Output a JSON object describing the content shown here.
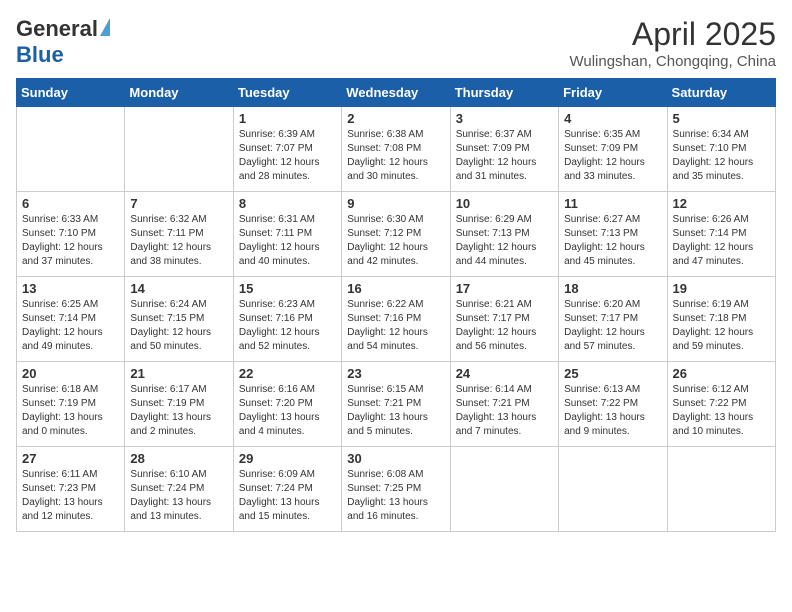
{
  "header": {
    "logo_general": "General",
    "logo_blue": "Blue",
    "month": "April 2025",
    "location": "Wulingshan, Chongqing, China"
  },
  "days_of_week": [
    "Sunday",
    "Monday",
    "Tuesday",
    "Wednesday",
    "Thursday",
    "Friday",
    "Saturday"
  ],
  "weeks": [
    [
      {
        "day": "",
        "info": ""
      },
      {
        "day": "",
        "info": ""
      },
      {
        "day": "1",
        "info": "Sunrise: 6:39 AM\nSunset: 7:07 PM\nDaylight: 12 hours and 28 minutes."
      },
      {
        "day": "2",
        "info": "Sunrise: 6:38 AM\nSunset: 7:08 PM\nDaylight: 12 hours and 30 minutes."
      },
      {
        "day": "3",
        "info": "Sunrise: 6:37 AM\nSunset: 7:09 PM\nDaylight: 12 hours and 31 minutes."
      },
      {
        "day": "4",
        "info": "Sunrise: 6:35 AM\nSunset: 7:09 PM\nDaylight: 12 hours and 33 minutes."
      },
      {
        "day": "5",
        "info": "Sunrise: 6:34 AM\nSunset: 7:10 PM\nDaylight: 12 hours and 35 minutes."
      }
    ],
    [
      {
        "day": "6",
        "info": "Sunrise: 6:33 AM\nSunset: 7:10 PM\nDaylight: 12 hours and 37 minutes."
      },
      {
        "day": "7",
        "info": "Sunrise: 6:32 AM\nSunset: 7:11 PM\nDaylight: 12 hours and 38 minutes."
      },
      {
        "day": "8",
        "info": "Sunrise: 6:31 AM\nSunset: 7:11 PM\nDaylight: 12 hours and 40 minutes."
      },
      {
        "day": "9",
        "info": "Sunrise: 6:30 AM\nSunset: 7:12 PM\nDaylight: 12 hours and 42 minutes."
      },
      {
        "day": "10",
        "info": "Sunrise: 6:29 AM\nSunset: 7:13 PM\nDaylight: 12 hours and 44 minutes."
      },
      {
        "day": "11",
        "info": "Sunrise: 6:27 AM\nSunset: 7:13 PM\nDaylight: 12 hours and 45 minutes."
      },
      {
        "day": "12",
        "info": "Sunrise: 6:26 AM\nSunset: 7:14 PM\nDaylight: 12 hours and 47 minutes."
      }
    ],
    [
      {
        "day": "13",
        "info": "Sunrise: 6:25 AM\nSunset: 7:14 PM\nDaylight: 12 hours and 49 minutes."
      },
      {
        "day": "14",
        "info": "Sunrise: 6:24 AM\nSunset: 7:15 PM\nDaylight: 12 hours and 50 minutes."
      },
      {
        "day": "15",
        "info": "Sunrise: 6:23 AM\nSunset: 7:16 PM\nDaylight: 12 hours and 52 minutes."
      },
      {
        "day": "16",
        "info": "Sunrise: 6:22 AM\nSunset: 7:16 PM\nDaylight: 12 hours and 54 minutes."
      },
      {
        "day": "17",
        "info": "Sunrise: 6:21 AM\nSunset: 7:17 PM\nDaylight: 12 hours and 56 minutes."
      },
      {
        "day": "18",
        "info": "Sunrise: 6:20 AM\nSunset: 7:17 PM\nDaylight: 12 hours and 57 minutes."
      },
      {
        "day": "19",
        "info": "Sunrise: 6:19 AM\nSunset: 7:18 PM\nDaylight: 12 hours and 59 minutes."
      }
    ],
    [
      {
        "day": "20",
        "info": "Sunrise: 6:18 AM\nSunset: 7:19 PM\nDaylight: 13 hours and 0 minutes."
      },
      {
        "day": "21",
        "info": "Sunrise: 6:17 AM\nSunset: 7:19 PM\nDaylight: 13 hours and 2 minutes."
      },
      {
        "day": "22",
        "info": "Sunrise: 6:16 AM\nSunset: 7:20 PM\nDaylight: 13 hours and 4 minutes."
      },
      {
        "day": "23",
        "info": "Sunrise: 6:15 AM\nSunset: 7:21 PM\nDaylight: 13 hours and 5 minutes."
      },
      {
        "day": "24",
        "info": "Sunrise: 6:14 AM\nSunset: 7:21 PM\nDaylight: 13 hours and 7 minutes."
      },
      {
        "day": "25",
        "info": "Sunrise: 6:13 AM\nSunset: 7:22 PM\nDaylight: 13 hours and 9 minutes."
      },
      {
        "day": "26",
        "info": "Sunrise: 6:12 AM\nSunset: 7:22 PM\nDaylight: 13 hours and 10 minutes."
      }
    ],
    [
      {
        "day": "27",
        "info": "Sunrise: 6:11 AM\nSunset: 7:23 PM\nDaylight: 13 hours and 12 minutes."
      },
      {
        "day": "28",
        "info": "Sunrise: 6:10 AM\nSunset: 7:24 PM\nDaylight: 13 hours and 13 minutes."
      },
      {
        "day": "29",
        "info": "Sunrise: 6:09 AM\nSunset: 7:24 PM\nDaylight: 13 hours and 15 minutes."
      },
      {
        "day": "30",
        "info": "Sunrise: 6:08 AM\nSunset: 7:25 PM\nDaylight: 13 hours and 16 minutes."
      },
      {
        "day": "",
        "info": ""
      },
      {
        "day": "",
        "info": ""
      },
      {
        "day": "",
        "info": ""
      }
    ]
  ]
}
